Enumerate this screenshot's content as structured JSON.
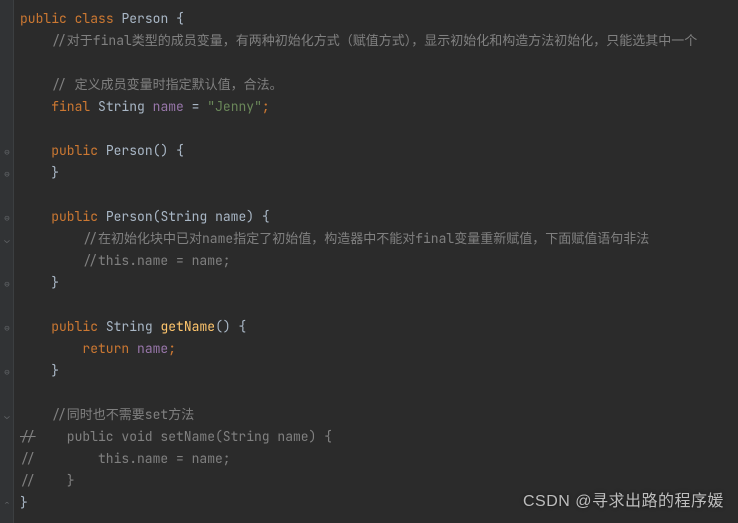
{
  "code": {
    "l1": {
      "k_public": "public",
      "k_class": "class",
      "cls": "Person",
      "br": "{"
    },
    "l2": {
      "cmt": "//对于final类型的成员变量，有两种初始化方式（赋值方式），显示初始化和构造方法初始化，只能选其中一个"
    },
    "l3": {
      "": ""
    },
    "l4": {
      "cmt": "// 定义成员变量时指定默认值，合法。"
    },
    "l5": {
      "k_final": "final",
      "type": "String",
      "field": "name",
      "eq": "=",
      "str": "\"Jenny\"",
      "semi": ";"
    },
    "l6": {
      "": ""
    },
    "l7": {
      "k_public": "public",
      "ctor": "Person",
      "par": "()",
      "br": "{"
    },
    "l8": {
      "br": "}"
    },
    "l9": {
      "": ""
    },
    "l10": {
      "k_public": "public",
      "ctor": "Person",
      "lp": "(",
      "ptype": "String",
      "pname": "name",
      "rp": ")",
      "br": "{"
    },
    "l11": {
      "cmt": "//在初始化块中已对name指定了初始值，构造器中不能对final变量重新赋值，下面赋值语句非法"
    },
    "l12": {
      "cmt": "//this.name = name;"
    },
    "l13": {
      "br": "}"
    },
    "l14": {
      "": ""
    },
    "l15": {
      "k_public": "public",
      "type": "String",
      "mth": "getName",
      "par": "()",
      "br": "{"
    },
    "l16": {
      "k_return": "return",
      "field": "name",
      "semi": ";"
    },
    "l17": {
      "br": "}"
    },
    "l18": {
      "": ""
    },
    "l19": {
      "cmt": "//同时也不需要set方法"
    },
    "l20": {
      "cmt_lead": "//",
      "cmt_rest": "    public void setName(String name) {"
    },
    "l21": {
      "cmt": "//        this.name = name;"
    },
    "l22": {
      "cmt": "//    }"
    },
    "l23": {
      "br": "}"
    }
  },
  "watermark": "CSDN @寻求出路的程序媛"
}
